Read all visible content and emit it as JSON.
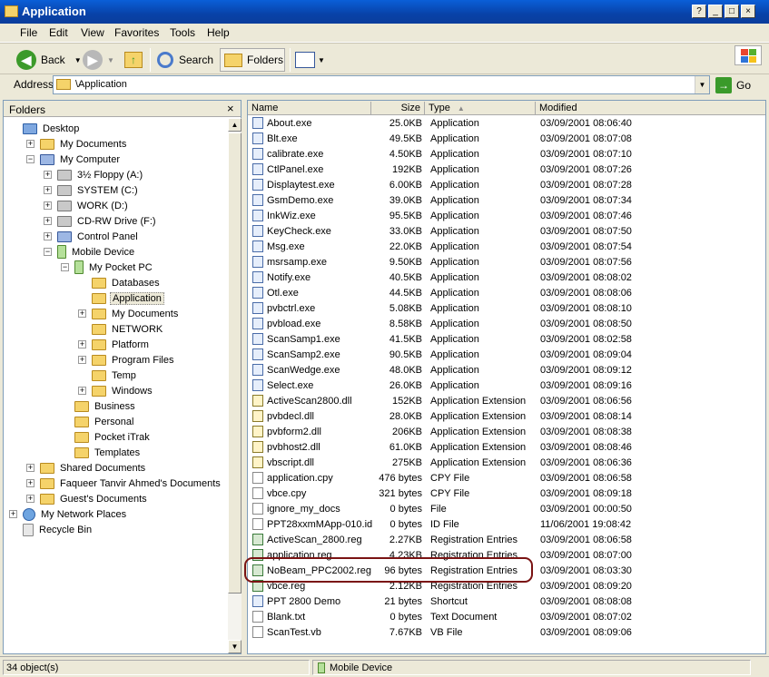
{
  "window": {
    "title": "Application",
    "controls": [
      "?",
      "_",
      "□",
      "×"
    ]
  },
  "menu": [
    "File",
    "Edit",
    "View",
    "Favorites",
    "Tools",
    "Help"
  ],
  "toolbar": {
    "back": "Back",
    "search": "Search",
    "folders": "Folders"
  },
  "address": {
    "label": "Address",
    "value": "\\Application",
    "go": "Go"
  },
  "folders_pane": {
    "title": "Folders",
    "close": "×",
    "tree": [
      {
        "label": "Desktop",
        "icon": "desktop-icon",
        "expander": ""
      },
      {
        "label": "My Documents",
        "icon": "folder-icon",
        "expander": "+"
      },
      {
        "label": "My Computer",
        "icon": "computer-icon",
        "expander": "−"
      },
      {
        "label": "3½ Floppy (A:)",
        "icon": "floppy-drive-icon",
        "expander": "+"
      },
      {
        "label": "SYSTEM (C:)",
        "icon": "hard-drive-icon",
        "expander": "+"
      },
      {
        "label": "WORK (D:)",
        "icon": "hard-drive-icon",
        "expander": "+"
      },
      {
        "label": "CD-RW Drive (F:)",
        "icon": "cd-drive-icon",
        "expander": "+"
      },
      {
        "label": "Control Panel",
        "icon": "control-panel-icon",
        "expander": "+"
      },
      {
        "label": "Mobile Device",
        "icon": "mobile-device-icon",
        "expander": "−"
      },
      {
        "label": "My Pocket PC",
        "icon": "pocket-pc-icon",
        "expander": "−"
      },
      {
        "label": "Databases",
        "icon": "folder-icon",
        "expander": ""
      },
      {
        "label": "Application",
        "icon": "folder-open-icon",
        "expander": ""
      },
      {
        "label": "My Documents",
        "icon": "folder-icon",
        "expander": "+"
      },
      {
        "label": "NETWORK",
        "icon": "folder-icon",
        "expander": ""
      },
      {
        "label": "Platform",
        "icon": "folder-icon",
        "expander": "+"
      },
      {
        "label": "Program Files",
        "icon": "folder-icon",
        "expander": "+"
      },
      {
        "label": "Temp",
        "icon": "folder-icon",
        "expander": ""
      },
      {
        "label": "Windows",
        "icon": "folder-icon",
        "expander": "+"
      },
      {
        "label": "Business",
        "icon": "folder-icon",
        "expander": ""
      },
      {
        "label": "Personal",
        "icon": "folder-icon",
        "expander": ""
      },
      {
        "label": "Pocket iTrak",
        "icon": "folder-icon",
        "expander": ""
      },
      {
        "label": "Templates",
        "icon": "folder-icon",
        "expander": ""
      },
      {
        "label": "Shared Documents",
        "icon": "folder-icon",
        "expander": "+"
      },
      {
        "label": "Faqueer Tanvir Ahmed's Documents",
        "icon": "folder-icon",
        "expander": "+"
      },
      {
        "label": "Guest's Documents",
        "icon": "folder-icon",
        "expander": "+"
      },
      {
        "label": "My Network Places",
        "icon": "network-icon",
        "expander": "+"
      },
      {
        "label": "Recycle Bin",
        "icon": "recycle-bin-icon",
        "expander": ""
      }
    ]
  },
  "columns": {
    "name": "Name",
    "size": "Size",
    "type": "Type",
    "modified": "Modified"
  },
  "files": [
    {
      "name": "About.exe",
      "size": "25.0KB",
      "type": "Application",
      "modified": "03/09/2001 08:06:40"
    },
    {
      "name": "Blt.exe",
      "size": "49.5KB",
      "type": "Application",
      "modified": "03/09/2001 08:07:08"
    },
    {
      "name": "calibrate.exe",
      "size": "4.50KB",
      "type": "Application",
      "modified": "03/09/2001 08:07:10"
    },
    {
      "name": "CtlPanel.exe",
      "size": "192KB",
      "type": "Application",
      "modified": "03/09/2001 08:07:26"
    },
    {
      "name": "Displaytest.exe",
      "size": "6.00KB",
      "type": "Application",
      "modified": "03/09/2001 08:07:28"
    },
    {
      "name": "GsmDemo.exe",
      "size": "39.0KB",
      "type": "Application",
      "modified": "03/09/2001 08:07:34"
    },
    {
      "name": "InkWiz.exe",
      "size": "95.5KB",
      "type": "Application",
      "modified": "03/09/2001 08:07:46"
    },
    {
      "name": "KeyCheck.exe",
      "size": "33.0KB",
      "type": "Application",
      "modified": "03/09/2001 08:07:50"
    },
    {
      "name": "Msg.exe",
      "size": "22.0KB",
      "type": "Application",
      "modified": "03/09/2001 08:07:54"
    },
    {
      "name": "msrsamp.exe",
      "size": "9.50KB",
      "type": "Application",
      "modified": "03/09/2001 08:07:56"
    },
    {
      "name": "Notify.exe",
      "size": "40.5KB",
      "type": "Application",
      "modified": "03/09/2001 08:08:02"
    },
    {
      "name": "Otl.exe",
      "size": "44.5KB",
      "type": "Application",
      "modified": "03/09/2001 08:08:06"
    },
    {
      "name": "pvbctrl.exe",
      "size": "5.08KB",
      "type": "Application",
      "modified": "03/09/2001 08:08:10"
    },
    {
      "name": "pvbload.exe",
      "size": "8.58KB",
      "type": "Application",
      "modified": "03/09/2001 08:08:50"
    },
    {
      "name": "ScanSamp1.exe",
      "size": "41.5KB",
      "type": "Application",
      "modified": "03/09/2001 08:02:58"
    },
    {
      "name": "ScanSamp2.exe",
      "size": "90.5KB",
      "type": "Application",
      "modified": "03/09/2001 08:09:04"
    },
    {
      "name": "ScanWedge.exe",
      "size": "48.0KB",
      "type": "Application",
      "modified": "03/09/2001 08:09:12"
    },
    {
      "name": "Select.exe",
      "size": "26.0KB",
      "type": "Application",
      "modified": "03/09/2001 08:09:16"
    },
    {
      "name": "ActiveScan2800.dll",
      "size": "152KB",
      "type": "Application Extension",
      "modified": "03/09/2001 08:06:56"
    },
    {
      "name": "pvbdecl.dll",
      "size": "28.0KB",
      "type": "Application Extension",
      "modified": "03/09/2001 08:08:14"
    },
    {
      "name": "pvbform2.dll",
      "size": "206KB",
      "type": "Application Extension",
      "modified": "03/09/2001 08:08:38"
    },
    {
      "name": "pvbhost2.dll",
      "size": "61.0KB",
      "type": "Application Extension",
      "modified": "03/09/2001 08:08:46"
    },
    {
      "name": "vbscript.dll",
      "size": "275KB",
      "type": "Application Extension",
      "modified": "03/09/2001 08:06:36"
    },
    {
      "name": "application.cpy",
      "size": "476 bytes",
      "type": "CPY File",
      "modified": "03/09/2001 08:06:58"
    },
    {
      "name": "vbce.cpy",
      "size": "321 bytes",
      "type": "CPY File",
      "modified": "03/09/2001 08:09:18"
    },
    {
      "name": "ignore_my_docs",
      "size": "0 bytes",
      "type": "File",
      "modified": "03/09/2001 00:00:50"
    },
    {
      "name": "PPT28xxmMApp-010.id",
      "size": "0 bytes",
      "type": "ID File",
      "modified": "11/06/2001 19:08:42"
    },
    {
      "name": "ActiveScan_2800.reg",
      "size": "2.27KB",
      "type": "Registration Entries",
      "modified": "03/09/2001 08:06:58"
    },
    {
      "name": "application.reg",
      "size": "4.23KB",
      "type": "Registration Entries",
      "modified": "03/09/2001 08:07:00"
    },
    {
      "name": "NoBeam_PPC2002.reg",
      "size": "96 bytes",
      "type": "Registration Entries",
      "modified": "03/09/2001 08:03:30"
    },
    {
      "name": "vbce.reg",
      "size": "2.12KB",
      "type": "Registration Entries",
      "modified": "03/09/2001 08:09:20"
    },
    {
      "name": "PPT 2800 Demo",
      "size": "21 bytes",
      "type": "Shortcut",
      "modified": "03/09/2001 08:08:08"
    },
    {
      "name": "Blank.txt",
      "size": "0 bytes",
      "type": "Text Document",
      "modified": "03/09/2001 08:07:02"
    },
    {
      "name": "ScanTest.vb",
      "size": "7.67KB",
      "type": "VB File",
      "modified": "03/09/2001 08:09:06"
    }
  ],
  "status": {
    "count": "34 object(s)",
    "location": "Mobile Device"
  }
}
